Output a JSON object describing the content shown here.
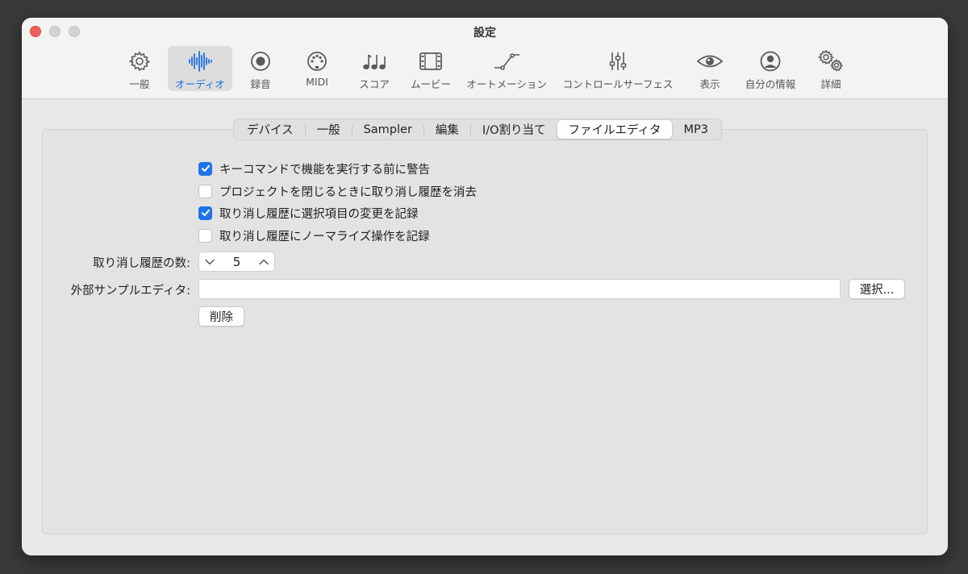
{
  "window": {
    "title": "設定"
  },
  "toolbar": {
    "items": [
      {
        "label": "一般",
        "icon": "gear-icon"
      },
      {
        "label": "オーディオ",
        "icon": "waveform-icon",
        "active": true
      },
      {
        "label": "録音",
        "icon": "record-icon"
      },
      {
        "label": "MIDI",
        "icon": "midi-connector-icon"
      },
      {
        "label": "スコア",
        "icon": "music-notes-icon"
      },
      {
        "label": "ムービー",
        "icon": "film-icon"
      },
      {
        "label": "オートメーション",
        "icon": "automation-icon"
      },
      {
        "label": "コントロールサーフェス",
        "icon": "sliders-icon"
      },
      {
        "label": "表示",
        "icon": "eye-icon"
      },
      {
        "label": "自分の情報",
        "icon": "person-icon"
      },
      {
        "label": "詳細",
        "icon": "gears-icon"
      }
    ]
  },
  "tabs": [
    {
      "label": "デバイス"
    },
    {
      "label": "一般"
    },
    {
      "label": "Sampler"
    },
    {
      "label": "編集"
    },
    {
      "label": "I/O割り当て"
    },
    {
      "label": "ファイルエディタ",
      "active": true
    },
    {
      "label": "MP3"
    }
  ],
  "options": [
    {
      "label": "キーコマンドで機能を実行する前に警告",
      "checked": true
    },
    {
      "label": "プロジェクトを閉じるときに取り消し履歴を消去",
      "checked": false
    },
    {
      "label": "取り消し履歴に選択項目の変更を記録",
      "checked": true
    },
    {
      "label": "取り消し履歴にノーマライズ操作を記録",
      "checked": false
    }
  ],
  "undo_count": {
    "label": "取り消し履歴の数:",
    "value": "5"
  },
  "external_editor": {
    "label": "外部サンプルエディタ:",
    "value": "",
    "choose_label": "選択..."
  },
  "delete_label": "削除",
  "colors": {
    "accent": "#1f73e8",
    "close": "#ee5f57"
  }
}
